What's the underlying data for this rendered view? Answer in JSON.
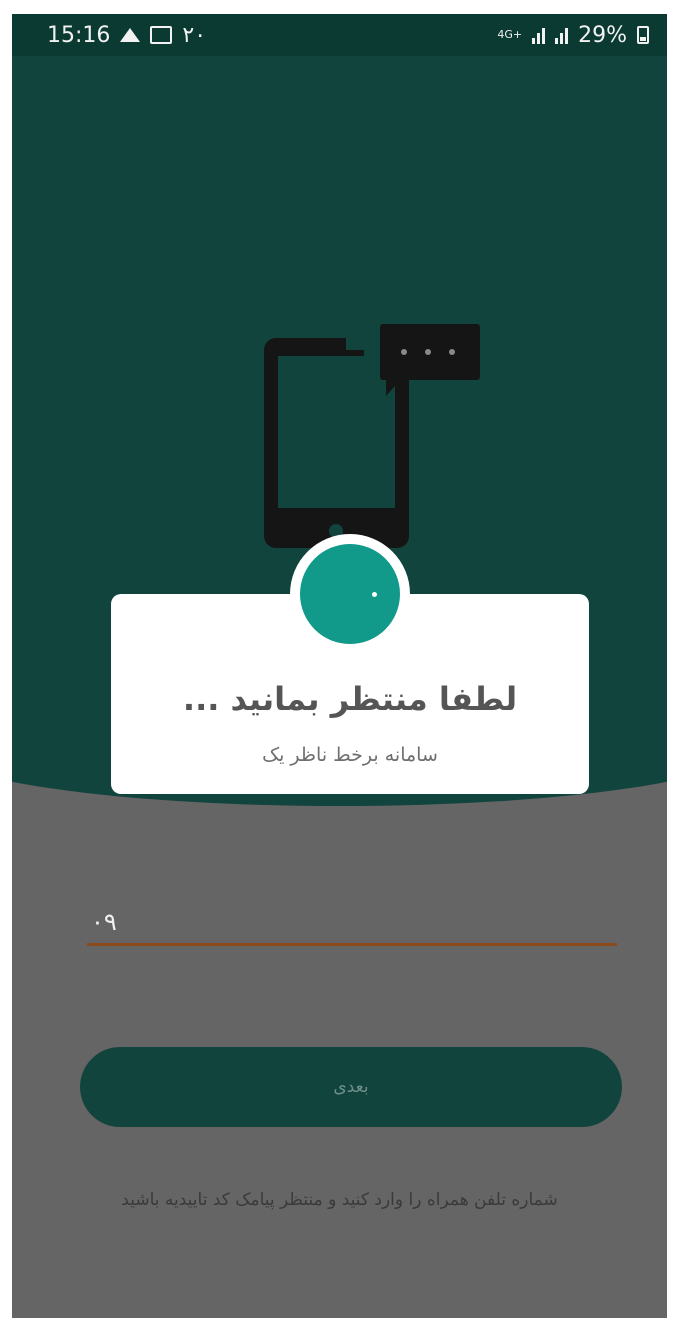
{
  "status_bar": {
    "time": "15:16",
    "notification_count": "۲۰",
    "network_badge": "4G+",
    "battery": "29%"
  },
  "icons": {
    "illustration": "phone-message-icon",
    "loader": "spinner-icon"
  },
  "dialog": {
    "title": "لطفا منتظر بمانید ...",
    "subtitle": "سامانه برخط ناظر یک"
  },
  "form": {
    "phone_value": "۰۹",
    "next_label": "بعدی",
    "hint": "شماره تلفن همراه را وارد کنید و منتظر پیامک کد تاییدیه باشید"
  },
  "colors": {
    "header_green": "#12443e",
    "accent_teal": "#11998a",
    "overlay_gray": "#656565",
    "input_underline": "#8a4a1c"
  }
}
